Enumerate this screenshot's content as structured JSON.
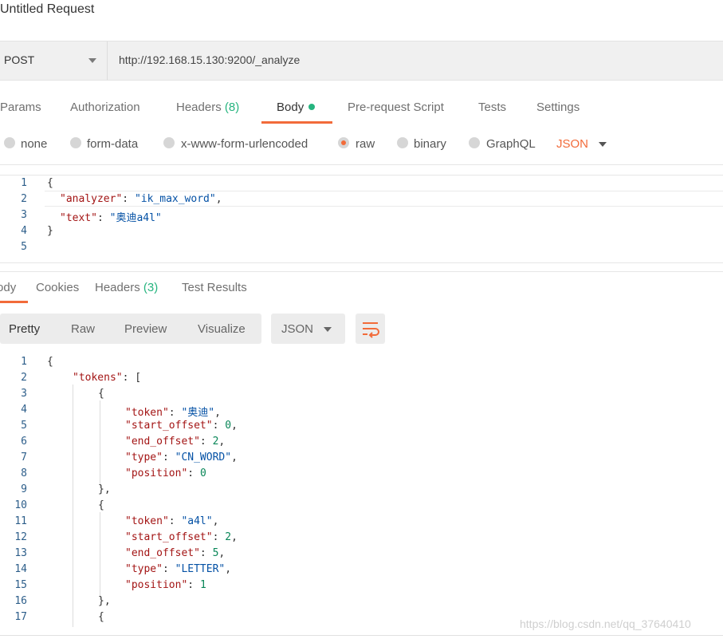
{
  "request": {
    "title": "Untitled Request",
    "method": "POST",
    "url": "http://192.168.15.130:9200/_analyze"
  },
  "request_tabs": {
    "params": "Params",
    "authorization": "Authorization",
    "headers": "Headers",
    "headers_count": "(8)",
    "body": "Body",
    "prerequest": "Pre-request Script",
    "tests": "Tests",
    "settings": "Settings"
  },
  "body_types": {
    "none": "none",
    "form_data": "form-data",
    "urlencoded": "x-www-form-urlencoded",
    "raw": "raw",
    "binary": "binary",
    "graphql": "GraphQL",
    "format": "JSON"
  },
  "request_body": {
    "line_numbers": [
      "1",
      "2",
      "3",
      "4",
      "5"
    ],
    "open": "{",
    "k1": "\"analyzer\"",
    "v1": "\"ik_max_word\"",
    "k2": "\"text\"",
    "v2": "\"奥迪a4l\"",
    "close": "}"
  },
  "response_tabs": {
    "body": "Body",
    "cookies": "Cookies",
    "headers": "Headers",
    "headers_count": "(3)",
    "test_results": "Test Results"
  },
  "view_modes": {
    "pretty": "Pretty",
    "raw": "Raw",
    "preview": "Preview",
    "visualize": "Visualize",
    "format": "JSON"
  },
  "response_body": {
    "line_numbers": [
      "1",
      "2",
      "3",
      "4",
      "5",
      "6",
      "7",
      "8",
      "9",
      "10",
      "11",
      "12",
      "13",
      "14",
      "15",
      "16",
      "17"
    ],
    "open": "{",
    "tokens_key": "\"tokens\"",
    "bracket": "[",
    "obj_open": "{",
    "obj_close": "},",
    "t1": {
      "token": "\"奥迪\"",
      "start_offset": "0",
      "end_offset": "2",
      "type": "\"CN_WORD\"",
      "position": "0"
    },
    "t2": {
      "token": "\"a4l\"",
      "start_offset": "2",
      "end_offset": "5",
      "type": "\"LETTER\"",
      "position": "1"
    },
    "k_token": "\"token\"",
    "k_start": "\"start_offset\"",
    "k_end": "\"end_offset\"",
    "k_type": "\"type\"",
    "k_position": "\"position\""
  },
  "watermark": "https://blog.csdn.net/qq_37640410",
  "colors": {
    "accent": "#f26b3a",
    "green": "#26b47f",
    "key": "#a31515",
    "string": "#0451a5",
    "number": "#098658"
  }
}
